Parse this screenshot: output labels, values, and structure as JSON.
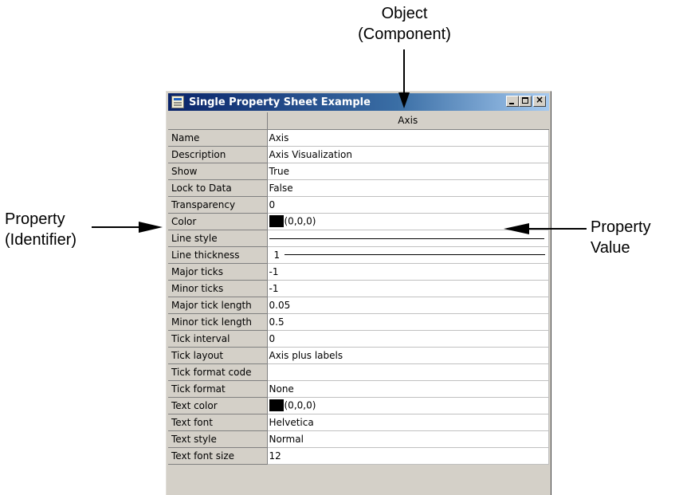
{
  "callouts": {
    "object": [
      "Object",
      "(Component)"
    ],
    "property": [
      "Property",
      "(Identifier)"
    ],
    "value": [
      "Property",
      "Value"
    ]
  },
  "window": {
    "title": "Single Property Sheet Example",
    "column_header": "Axis",
    "buttons": {
      "close": "×"
    }
  },
  "properties": [
    {
      "name": "Name",
      "value": "Axis",
      "kind": "text"
    },
    {
      "name": "Description",
      "value": "Axis Visualization",
      "kind": "text"
    },
    {
      "name": "Show",
      "value": "True",
      "kind": "text"
    },
    {
      "name": "Lock to Data",
      "value": "False",
      "kind": "text"
    },
    {
      "name": "Transparency",
      "value": "0",
      "kind": "text"
    },
    {
      "name": "Color",
      "value": "(0,0,0)",
      "kind": "color",
      "swatch": "#000000"
    },
    {
      "name": "Line style",
      "value": "",
      "kind": "linestyle"
    },
    {
      "name": "Line thickness",
      "value": "1",
      "kind": "thickness"
    },
    {
      "name": "Major ticks",
      "value": "-1",
      "kind": "text"
    },
    {
      "name": "Minor ticks",
      "value": "-1",
      "kind": "text"
    },
    {
      "name": "Major tick length",
      "value": "0.05",
      "kind": "text"
    },
    {
      "name": "Minor tick length",
      "value": "0.5",
      "kind": "text"
    },
    {
      "name": "Tick interval",
      "value": "0",
      "kind": "text"
    },
    {
      "name": "Tick layout",
      "value": "Axis plus labels",
      "kind": "text"
    },
    {
      "name": "Tick format code",
      "value": "",
      "kind": "text"
    },
    {
      "name": "Tick format",
      "value": "None",
      "kind": "text"
    },
    {
      "name": "Text color",
      "value": "(0,0,0)",
      "kind": "color",
      "swatch": "#000000"
    },
    {
      "name": "Text font",
      "value": "Helvetica",
      "kind": "text"
    },
    {
      "name": "Text style",
      "value": "Normal",
      "kind": "text"
    },
    {
      "name": "Text font size",
      "value": "12",
      "kind": "text"
    }
  ],
  "colors": {
    "title_start": "#0a246a",
    "title_end": "#a6caf0",
    "panel": "#d4d0c8"
  }
}
